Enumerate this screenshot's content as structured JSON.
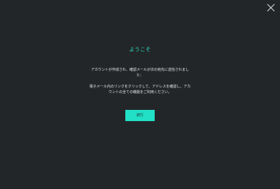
{
  "dialog": {
    "title": "ようこそ",
    "message_1": "アカウントが作成され、確認メールが次の宛先に送信されました：",
    "message_2": "電子メール内のリンクをクリックして、アドレスを確認し、アカウントの全ての機能をご利用ください。",
    "continue_label": "続行",
    "close_icon": "close-icon"
  },
  "colors": {
    "background": "#232628",
    "accent": "#21e0c6",
    "title": "#27e0c8",
    "text": "#e6e6e6",
    "close_icon": "#cfcfcf"
  }
}
